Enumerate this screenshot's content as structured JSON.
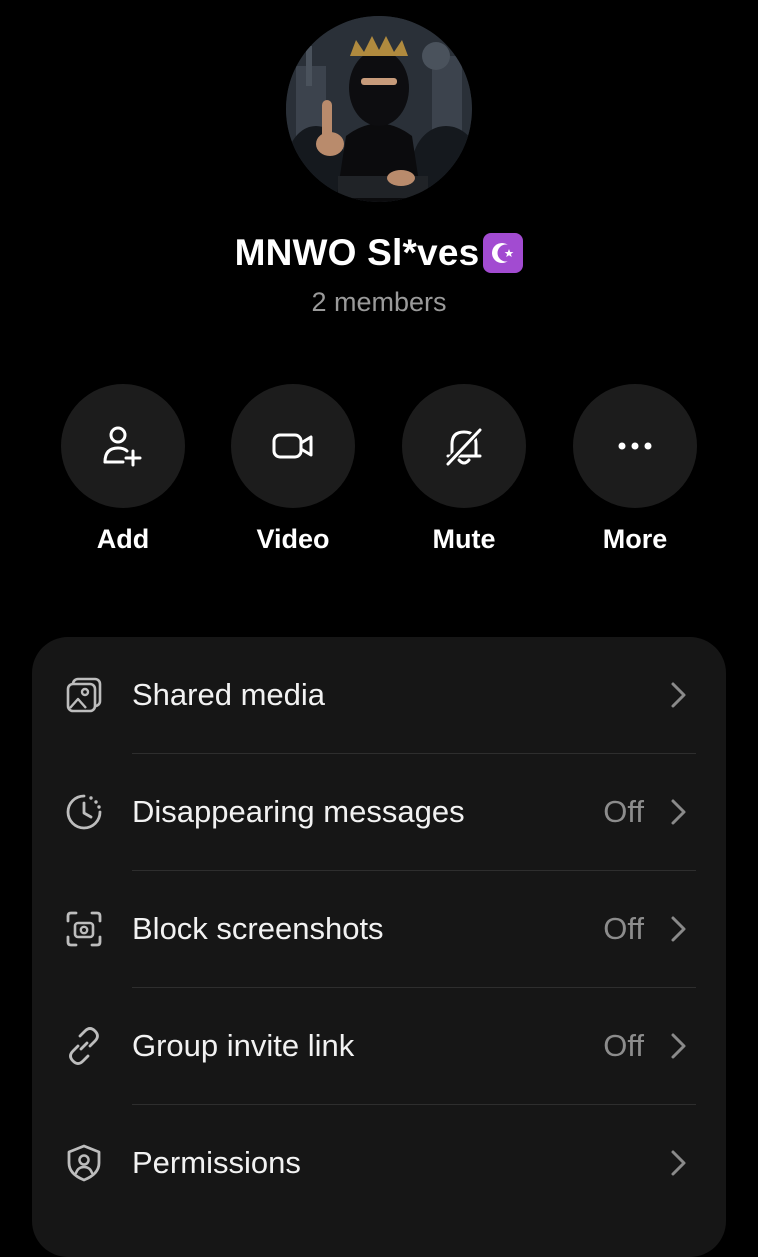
{
  "group": {
    "name": "MNWO Sl*ves",
    "members": "2 members"
  },
  "actions": [
    {
      "label": "Add",
      "icon": "add-person-icon"
    },
    {
      "label": "Video",
      "icon": "video-camera-icon"
    },
    {
      "label": "Mute",
      "icon": "bell-off-icon"
    },
    {
      "label": "More",
      "icon": "more-dots-icon"
    }
  ],
  "settings": [
    {
      "label": "Shared media",
      "value": "",
      "icon": "media-icon"
    },
    {
      "label": "Disappearing messages",
      "value": "Off",
      "icon": "timer-icon"
    },
    {
      "label": "Block screenshots",
      "value": "Off",
      "icon": "screenshot-block-icon"
    },
    {
      "label": "Group invite link",
      "value": "Off",
      "icon": "link-icon"
    },
    {
      "label": "Permissions",
      "value": "",
      "icon": "shield-person-icon"
    }
  ],
  "colors": {
    "background": "#000000",
    "card": "#161616",
    "button": "#1c1c1c",
    "muted_text": "#9a9a9a",
    "emoji_bg": "#a24bd1"
  }
}
